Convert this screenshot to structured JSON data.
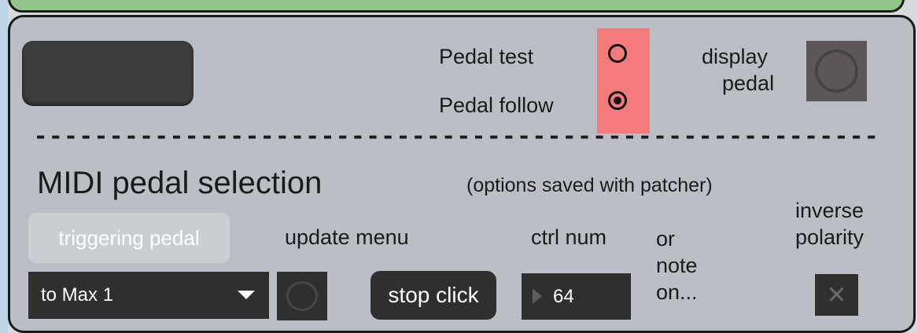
{
  "colors": {
    "panel_bg": "#b9bfc4",
    "top_strip": "#93c48a",
    "red_highlight": "#f47b79",
    "dark_control": "#2f2f2f",
    "light_button": "#c9ced2"
  },
  "pedal_mode": {
    "test_label": "Pedal test",
    "follow_label": "Pedal follow",
    "selected": "Pedal follow"
  },
  "display_pedal": {
    "label_line1": "display",
    "label_line2": "pedal",
    "icon": "circle-indicator-icon"
  },
  "separator": "-----------------------------------------------------------------------------------",
  "midi_section": {
    "title": "MIDI pedal selection",
    "note": "(options saved with patcher)",
    "triggering_button": "triggering pedal",
    "update_menu_label": "update menu",
    "ctrl_num_label": "ctrl num",
    "or_note_line1": "or",
    "or_note_line2": "note",
    "or_note_line3": "on...",
    "inverse_line1": "inverse",
    "inverse_line2": "polarity",
    "device_selected": "to Max 1",
    "stop_click_label": "stop click",
    "ctrl_num_value": "64",
    "inverse_polarity_checked": false
  }
}
